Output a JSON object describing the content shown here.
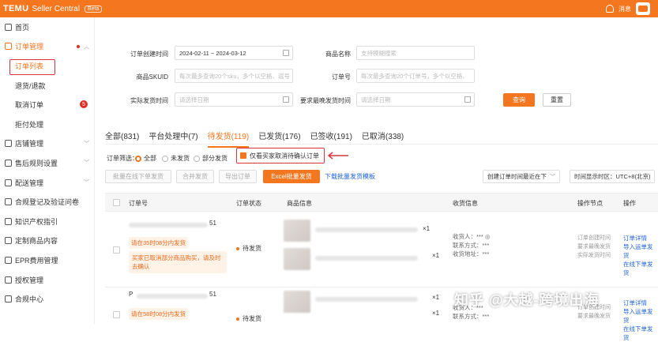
{
  "header": {
    "brand": "TEMU",
    "product": "Seller Central",
    "beta": "Beta",
    "notice": "消息"
  },
  "sidebar": {
    "items": [
      {
        "label": "首页"
      },
      {
        "label": "订单管理"
      },
      {
        "label": "订单列表"
      },
      {
        "label": "退货/退款"
      },
      {
        "label": "取消订单",
        "badge": "5"
      },
      {
        "label": "拒付处理"
      },
      {
        "label": "店铺管理"
      },
      {
        "label": "售后规则设置"
      },
      {
        "label": "配送管理"
      },
      {
        "label": "合规登记及验证问卷"
      },
      {
        "label": "知识产权指引"
      },
      {
        "label": "定制商品内容"
      },
      {
        "label": "EPR费用管理"
      },
      {
        "label": "授权管理"
      },
      {
        "label": "合规中心"
      }
    ]
  },
  "filters": {
    "created_label": "订单创建时间",
    "created_value": "2024-02-11 ~ 2024-03-12",
    "product_name_label": "商品名称",
    "product_name_ph": "支持模糊搜索",
    "skuid_label": "商品SKUID",
    "skuid_ph": "每次最多查询20个sku，多个以空格、逗号",
    "orderno_label": "订单号",
    "orderno_ph": "每次最多查询20个订单号，多个以空格、",
    "ship_label": "实际发货时间",
    "ship_ph": "请选择日期",
    "req_label": "要求最晚发货时间",
    "req_ph": "请选择日期",
    "query": "查询",
    "reset": "重置"
  },
  "tabs": [
    "全部(831)",
    "平台处理中(7)",
    "待发货(119)",
    "已发货(176)",
    "已签收(191)",
    "已取消(338)"
  ],
  "order_filter": {
    "label": "订单筛选：",
    "opt_all": "全部",
    "opt_unshipped": "未发货",
    "opt_partial": "部分发货",
    "cancel_only": "仅看买家取消待确认订单"
  },
  "actions": {
    "batch_online": "批量在线下单发货",
    "merge": "合并发货",
    "export": "导出订单",
    "excel": "Excel批量发货",
    "download": "下载批量发货模板",
    "sort_sel": "创建订单时间最近在下",
    "tz_sel": "时间显示时区：UTC+8(北京)"
  },
  "table": {
    "headers": [
      "订单号",
      "订单状态",
      "商品信息",
      "收货信息",
      "操作节点",
      "操作"
    ],
    "rows": [
      {
        "order_suffix": "51",
        "deadline": "请在35时08分内发货",
        "warn": "买家已取消部分商品购买，请及时去确认",
        "status": "待发货",
        "qty1": "×1",
        "qty2": "×1",
        "recv1": "收货人：",
        "recv1v": "***",
        "recv2": "联系方式：",
        "recv2v": "***",
        "recv3": "收货地址：",
        "recv3v": "***",
        "ops_gray": [
          "订单创建时间",
          "要求最晚发货",
          "实际发货时间"
        ],
        "ops_links": [
          "订单详情",
          "导入运单发货",
          "在线下单发货"
        ]
      },
      {
        "order_prefix": "P",
        "order_suffix": "51",
        "deadline": "请在58时08分内发货",
        "status": "待发货",
        "qty1": "×1",
        "qty2": "×1",
        "recv1": "收货人：",
        "recv1v": "***",
        "recv2": "联系方式：",
        "recv2v": "***",
        "ops_gray": [
          "订单创建时间",
          "要求最晚发货"
        ],
        "ops_links": [
          "订单详情",
          "导入运单发货",
          "在线下单发货"
        ]
      }
    ]
  },
  "watermark": "知乎 @大越-跨境出海",
  "colors": {
    "brand": "#f4761e",
    "highlight": "#d9363e",
    "link": "#1f64d8"
  }
}
